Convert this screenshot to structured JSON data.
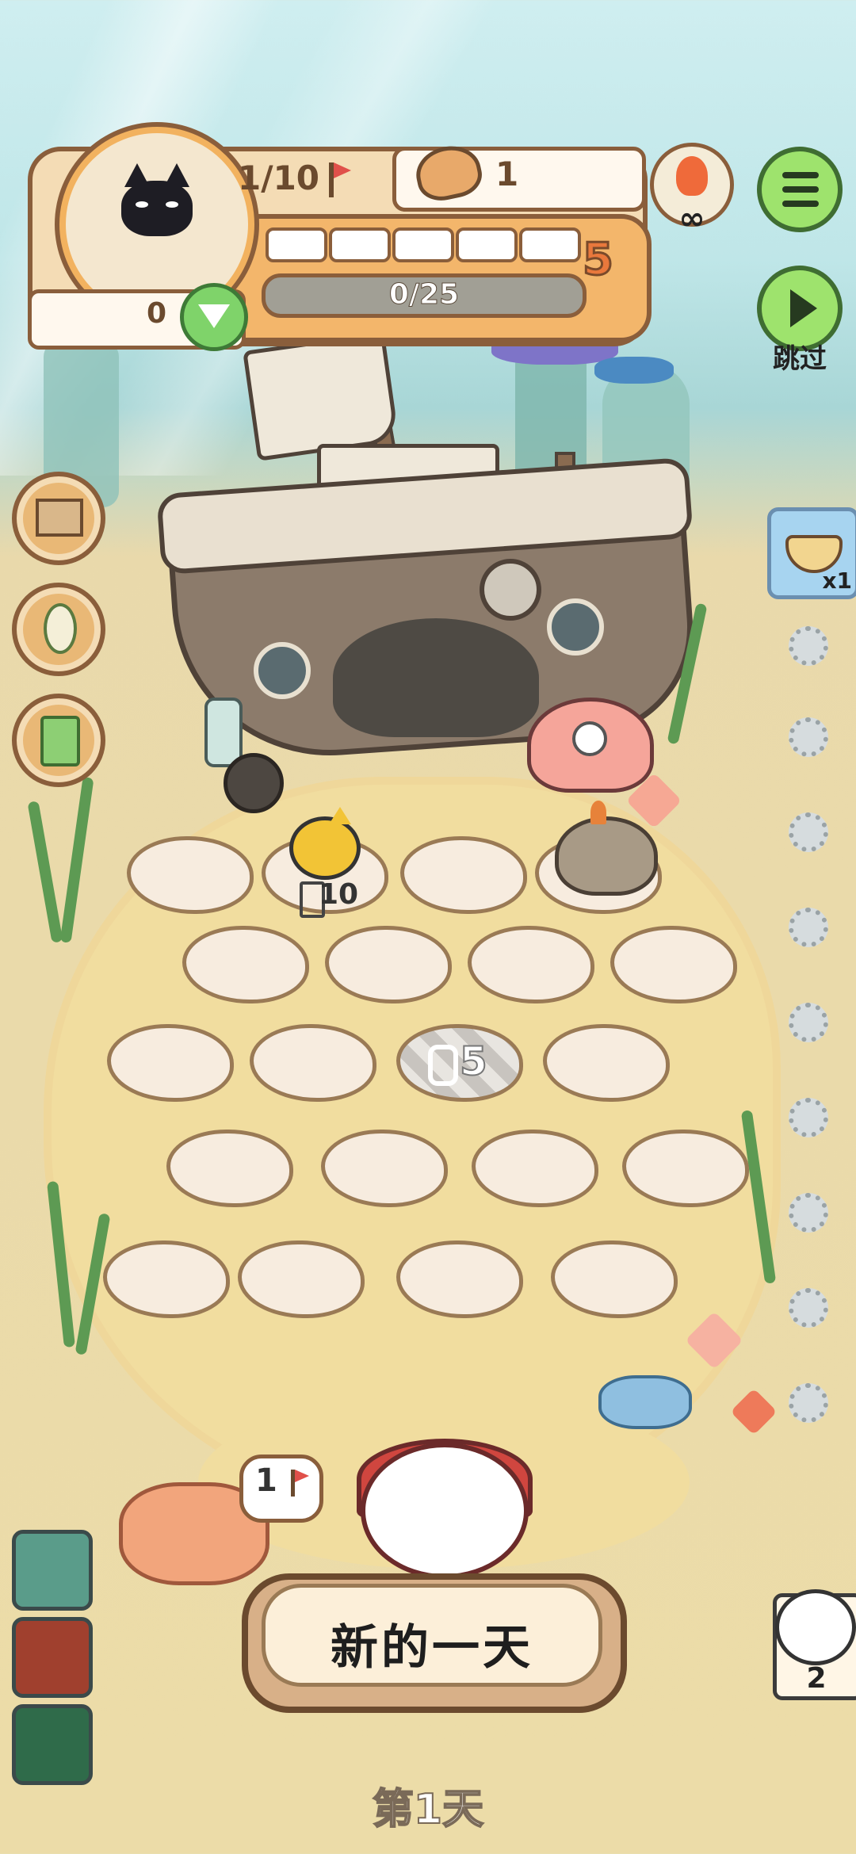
{
  "hud": {
    "route_progress": "1/10",
    "coins": "1",
    "level": "5",
    "xp": "0/25",
    "xp_fraction": 0,
    "gems": "0",
    "segments_filled": 0,
    "segments_total": 5
  },
  "controls": {
    "skip_label": "跳过",
    "infinite_symbol": "∞"
  },
  "inventory": {
    "bowl_count": "x1"
  },
  "board": {
    "bee_timer": "10",
    "locked_slot_cost": "5"
  },
  "bottom": {
    "speech_count": "1",
    "new_day_button": "新的一天",
    "day_label": "第1天",
    "guest_count": "2"
  },
  "colors": {
    "accent_orange": "#f3b66b",
    "panel_border": "#8a5e3b",
    "green_button": "#9ee36d",
    "sand": "#ecdca8"
  }
}
